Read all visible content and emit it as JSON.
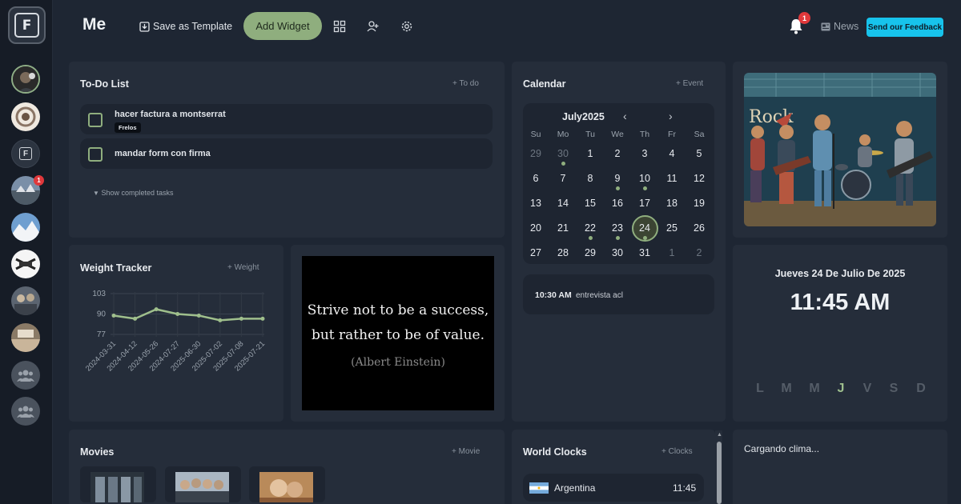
{
  "header": {
    "title": "Me",
    "save_template": "Save as Template",
    "add_widget": "Add Widget",
    "notifications_count": "1",
    "news": "News",
    "feedback": "Send our Feedback"
  },
  "sidebar": {
    "badge_count": "1"
  },
  "todo": {
    "title": "To-Do List",
    "action": "+ To do",
    "items": [
      {
        "text": "hacer factura a montserrat",
        "tag": "Frelos"
      },
      {
        "text": "mandar form con firma"
      }
    ],
    "show_completed": "Show completed tasks"
  },
  "calendar": {
    "title": "Calendar",
    "action": "+ Event",
    "month": "July2025",
    "weekdays": [
      "Su",
      "Mo",
      "Tu",
      "We",
      "Th",
      "Fr",
      "Sa"
    ],
    "weeks": [
      [
        "29",
        "30",
        "1",
        "2",
        "3",
        "4",
        "5"
      ],
      [
        "6",
        "7",
        "8",
        "9",
        "10",
        "11",
        "12"
      ],
      [
        "13",
        "14",
        "15",
        "16",
        "17",
        "18",
        "19"
      ],
      [
        "20",
        "21",
        "22",
        "23",
        "24",
        "25",
        "26"
      ],
      [
        "27",
        "28",
        "29",
        "30",
        "31",
        "1",
        "2"
      ]
    ],
    "today": "24",
    "event": {
      "time": "10:30 AM",
      "text": "entrevista acl"
    }
  },
  "weight": {
    "title": "Weight Tracker",
    "action": "+ Weight"
  },
  "chart_data": {
    "type": "line",
    "x": [
      "2024-03-31",
      "2024-04-12",
      "2024-05-26",
      "2024-07-27",
      "2025-06-30",
      "2025-07-02",
      "2025-07-08",
      "2025-07-21"
    ],
    "values": [
      89,
      87,
      93,
      90,
      89,
      86,
      87,
      87
    ],
    "ticks": [
      "103",
      "90",
      "77"
    ],
    "ylim": [
      77,
      103
    ],
    "grid": true,
    "color": "#9fbf8c"
  },
  "quote": {
    "line1": "Strive not to be a success,",
    "line2": "but rather to be of value.",
    "author": "(Albert Einstein)"
  },
  "clock": {
    "date": "Jueves 24 De Julio De 2025",
    "time": "11:45 AM",
    "days": [
      "L",
      "M",
      "M",
      "J",
      "V",
      "S",
      "D"
    ],
    "active_index": 3
  },
  "movies": {
    "title": "Movies",
    "action": "+ Movie"
  },
  "world_clocks": {
    "title": "World Clocks",
    "action": "+ Clocks",
    "items": [
      {
        "country": "Argentina",
        "time": "11:45"
      }
    ]
  },
  "weather": {
    "loading": "Cargando clima..."
  },
  "colors": {
    "accent": "#8fae7e",
    "background": "#1e2633",
    "card": "#252d3a",
    "feedback": "#17c3ec",
    "badge": "#e0383b"
  }
}
